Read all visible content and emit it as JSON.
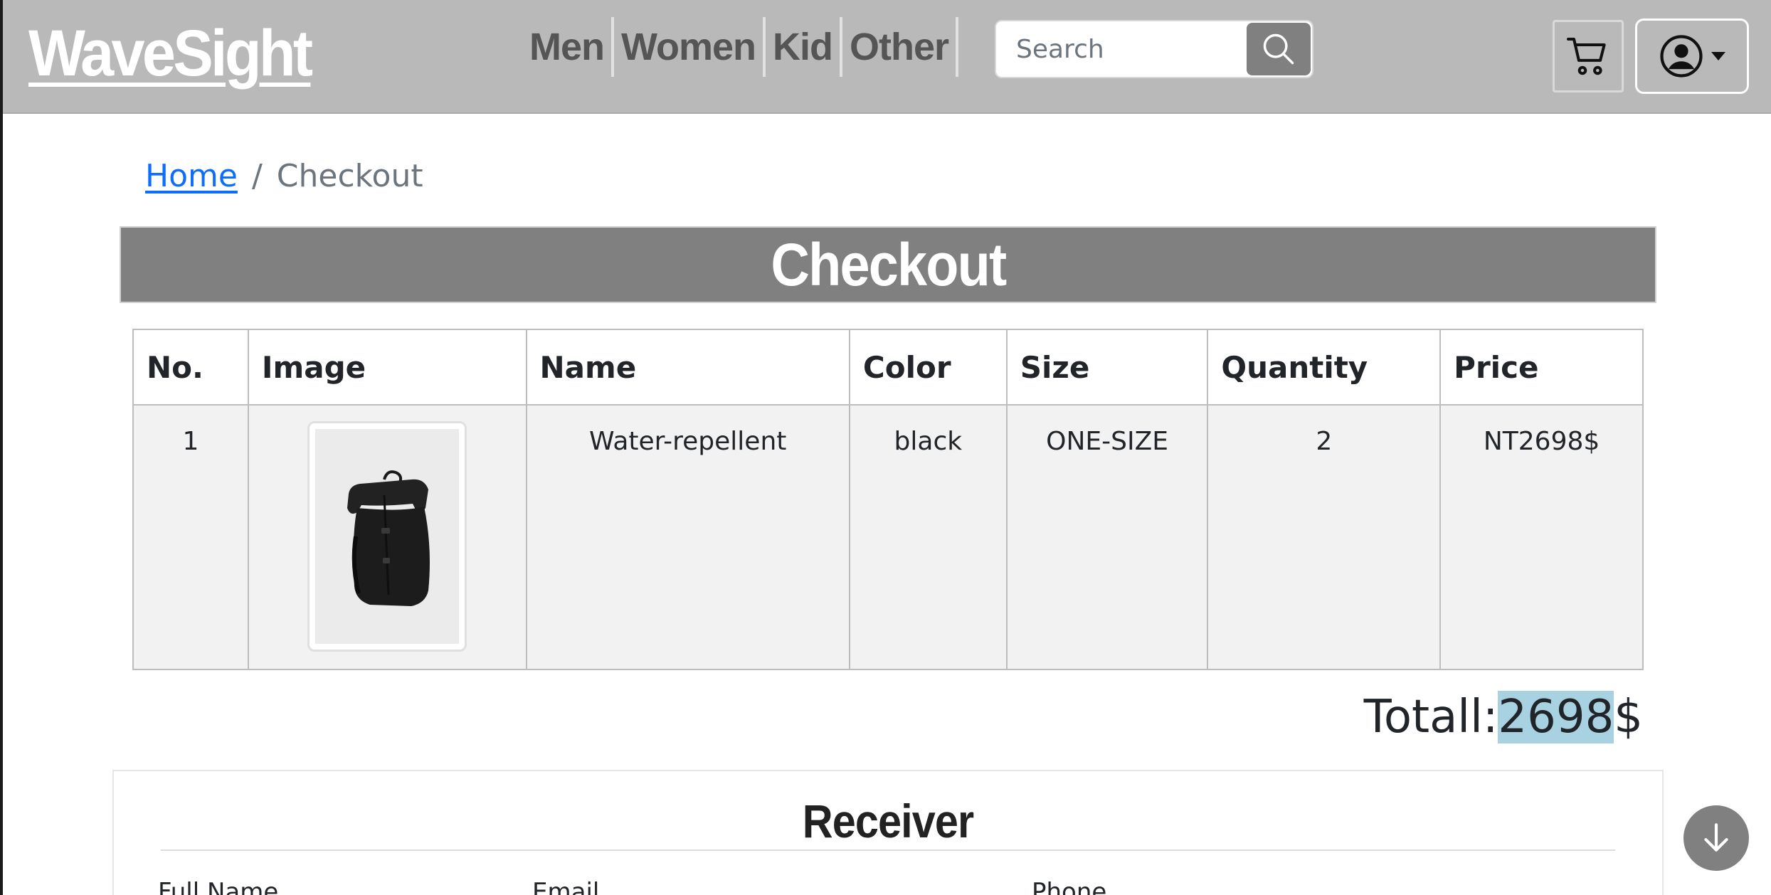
{
  "brand": "WaveSight",
  "nav": {
    "categories": [
      "Men",
      "Women",
      "Kid",
      "Other"
    ],
    "search_placeholder": "Search"
  },
  "breadcrumb": {
    "home": "Home",
    "separator": "/",
    "current": "Checkout"
  },
  "page_title": "Checkout",
  "table": {
    "headers": [
      "No.",
      "Image",
      "Name",
      "Color",
      "Size",
      "Quantity",
      "Price"
    ],
    "rows": [
      {
        "no": "1",
        "image": "black-backpack",
        "name": "Water-repellent",
        "color": "black",
        "size": "ONE-SIZE",
        "quantity": "2",
        "price": "NT2698$"
      }
    ]
  },
  "total": {
    "label": "Totall:",
    "value": "2698",
    "currency": "$"
  },
  "receiver": {
    "title": "Receiver",
    "fields": [
      "Full Name",
      "Email",
      "Phone"
    ]
  },
  "icons": {
    "search": "search-icon",
    "cart": "cart-icon",
    "user": "user-circle-icon",
    "caret": "caret-down-icon",
    "scroll": "arrow-down-icon"
  },
  "colors": {
    "navbar": "#b9b9b9",
    "accent_gray": "#808080",
    "link": "#0d6efd",
    "highlight": "#a8d1e2"
  }
}
